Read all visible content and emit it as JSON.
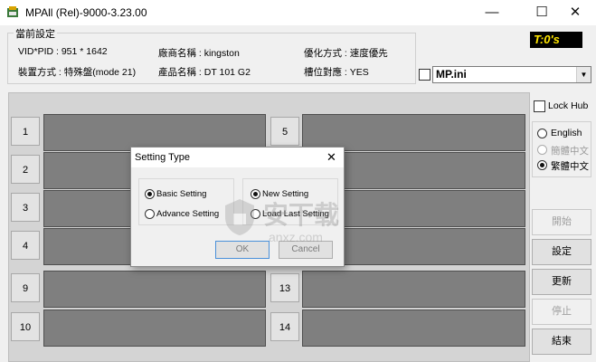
{
  "window": {
    "title": "MPAll (Rel)-9000-3.23.00",
    "minimize_glyph": "—",
    "maximize_glyph": "☐",
    "close_glyph": "✕"
  },
  "settings": {
    "legend": "當前設定",
    "vid_pid": "VID*PID : 951 * 1642",
    "vendor": "廠商名稱 : kingston",
    "optimize": "優化方式 : 速度優先",
    "mode": "裝置方式 : 特殊盤(mode 21)",
    "product": "產品名稱 : DT 101 G2",
    "slot": "槽位對應 : YES"
  },
  "timer": "T:0's",
  "ini": {
    "value": "MP.ini",
    "checked": false
  },
  "lock_hub": {
    "label": "Lock Hub",
    "checked": false
  },
  "languages": [
    {
      "label": "English",
      "selected": false,
      "disabled": false
    },
    {
      "label": "簡體中文",
      "selected": false,
      "disabled": true
    },
    {
      "label": "繁體中文",
      "selected": true,
      "disabled": false
    }
  ],
  "buttons": {
    "start": "開始",
    "settings": "設定",
    "update": "更新",
    "stop": "停止",
    "end": "結束"
  },
  "ports_left": [
    "1",
    "2",
    "3",
    "4",
    "9",
    "10"
  ],
  "ports_right": [
    "5",
    "13",
    "14"
  ],
  "dialog": {
    "title": "Setting Type",
    "close_glyph": "✕",
    "basic": "Basic Setting",
    "advance": "Advance Setting",
    "new": "New Setting",
    "load_last": "Load Last Setting",
    "ok": "OK",
    "cancel": "Cancel"
  },
  "watermark": {
    "text": "安下载",
    "url": "anxz.com"
  },
  "colors": {
    "timer_bg": "#000000",
    "timer_fg": "#ffe600",
    "port_bar": "#7f7f7f"
  }
}
